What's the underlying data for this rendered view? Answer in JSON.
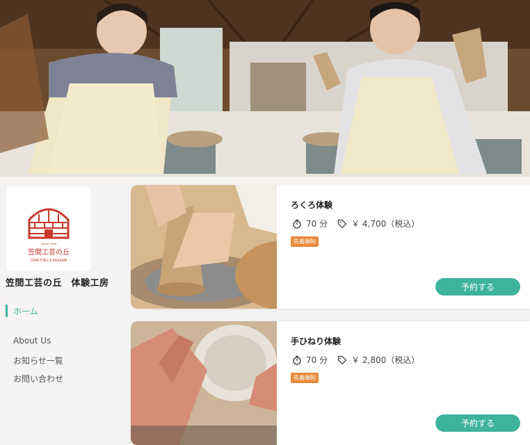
{
  "site": {
    "name": "笠間工芸の丘　体験工房",
    "logo": {
      "since": "SINCE 1999",
      "name_jp": "笠間工芸の丘",
      "name_en": "CRAFTHILLS KASAMA"
    }
  },
  "nav": {
    "active": "ホーム",
    "items": [
      "About Us",
      "お知らせ一覧",
      "お問い合わせ"
    ]
  },
  "experiences": [
    {
      "title": "ろくろ体験",
      "duration": "70 分",
      "price": "￥ 4,700（税込）",
      "badge": "先着順制",
      "button": "予約する"
    },
    {
      "title": "手ひねり体験",
      "duration": "70 分",
      "price": "￥ 2,800（税込）",
      "badge": "先着順制",
      "button": "予約する"
    }
  ],
  "colors": {
    "accent": "#3db39e",
    "badge": "#e88a3c",
    "brand_red": "#c8382c"
  },
  "icons": {
    "duration": "stopwatch-icon",
    "price": "tag-icon"
  }
}
